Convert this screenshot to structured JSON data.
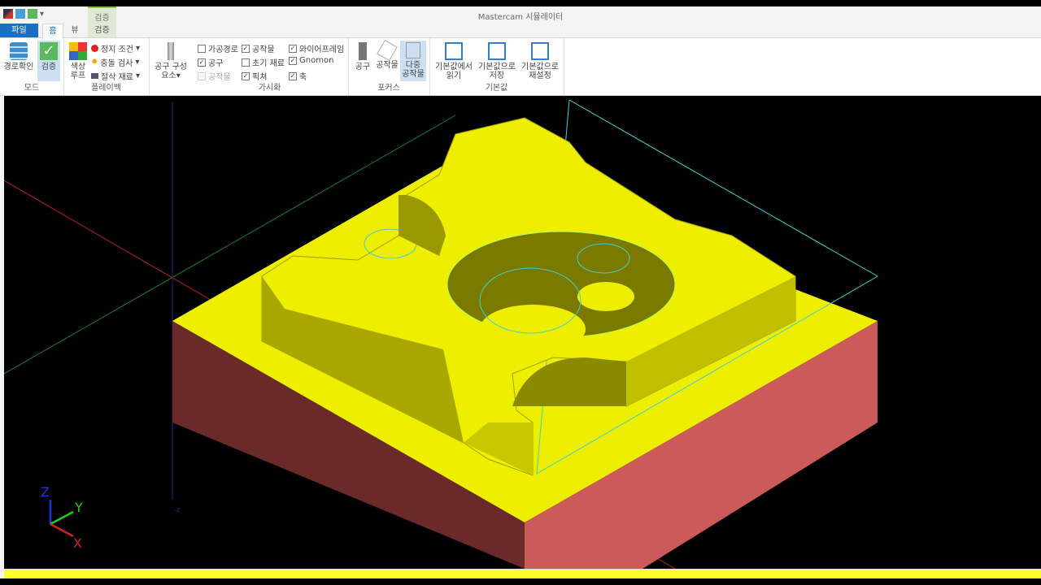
{
  "window": {
    "title": "Mastercam 시뮬레이터",
    "context_tab_group": "검증"
  },
  "tabs": {
    "file": "파일",
    "home": "홈",
    "view": "뷰",
    "verify": "검증"
  },
  "ribbon": {
    "mode": {
      "label": "모드",
      "backplot": "경로확인",
      "verify": "검증"
    },
    "playback": {
      "label": "플레이백",
      "color_loop_1": "색상",
      "color_loop_2": "루프",
      "stop_conditions": "정지 조건",
      "collision_check": "충돌 검사",
      "cut_stock": "절삭 재료"
    },
    "tool_components": {
      "line1": "공구 구성",
      "line2": "요소"
    },
    "visibility": {
      "label": "가시화",
      "items": [
        {
          "label": "가공경로",
          "checked": false,
          "enabled": true
        },
        {
          "label": "공구",
          "checked": true,
          "enabled": true
        },
        {
          "label": "공작물",
          "checked": false,
          "enabled": false
        },
        {
          "label": "공작물",
          "checked": true,
          "enabled": true
        },
        {
          "label": "초기 재료",
          "checked": false,
          "enabled": true
        },
        {
          "label": "픽쳐",
          "checked": true,
          "enabled": true
        },
        {
          "label": "와이어프레임",
          "checked": true,
          "enabled": true
        },
        {
          "label": "Gnomon",
          "checked": true,
          "enabled": true
        },
        {
          "label": "축",
          "checked": true,
          "enabled": true
        }
      ]
    },
    "focus": {
      "label": "포커스",
      "tool": "공구",
      "workpiece": "공작물",
      "multi_1": "다중",
      "multi_2": "공작물"
    },
    "defaults": {
      "label": "기본값",
      "load_1": "기본값에서",
      "load_2": "읽기",
      "save_1": "기본값으로",
      "save_2": "저장",
      "reset_1": "기본값으로",
      "reset_2": "재설정"
    }
  },
  "gnomon": {
    "x": "X",
    "y": "Y",
    "z": "Z"
  },
  "axis_label": "-z",
  "colors": {
    "stock_top": "#eeee00",
    "stock_front": "#6b2a2a",
    "stock_right": "#cd5a5a",
    "wire": "#40d0d0",
    "file_tab": "#1b6fc2"
  }
}
